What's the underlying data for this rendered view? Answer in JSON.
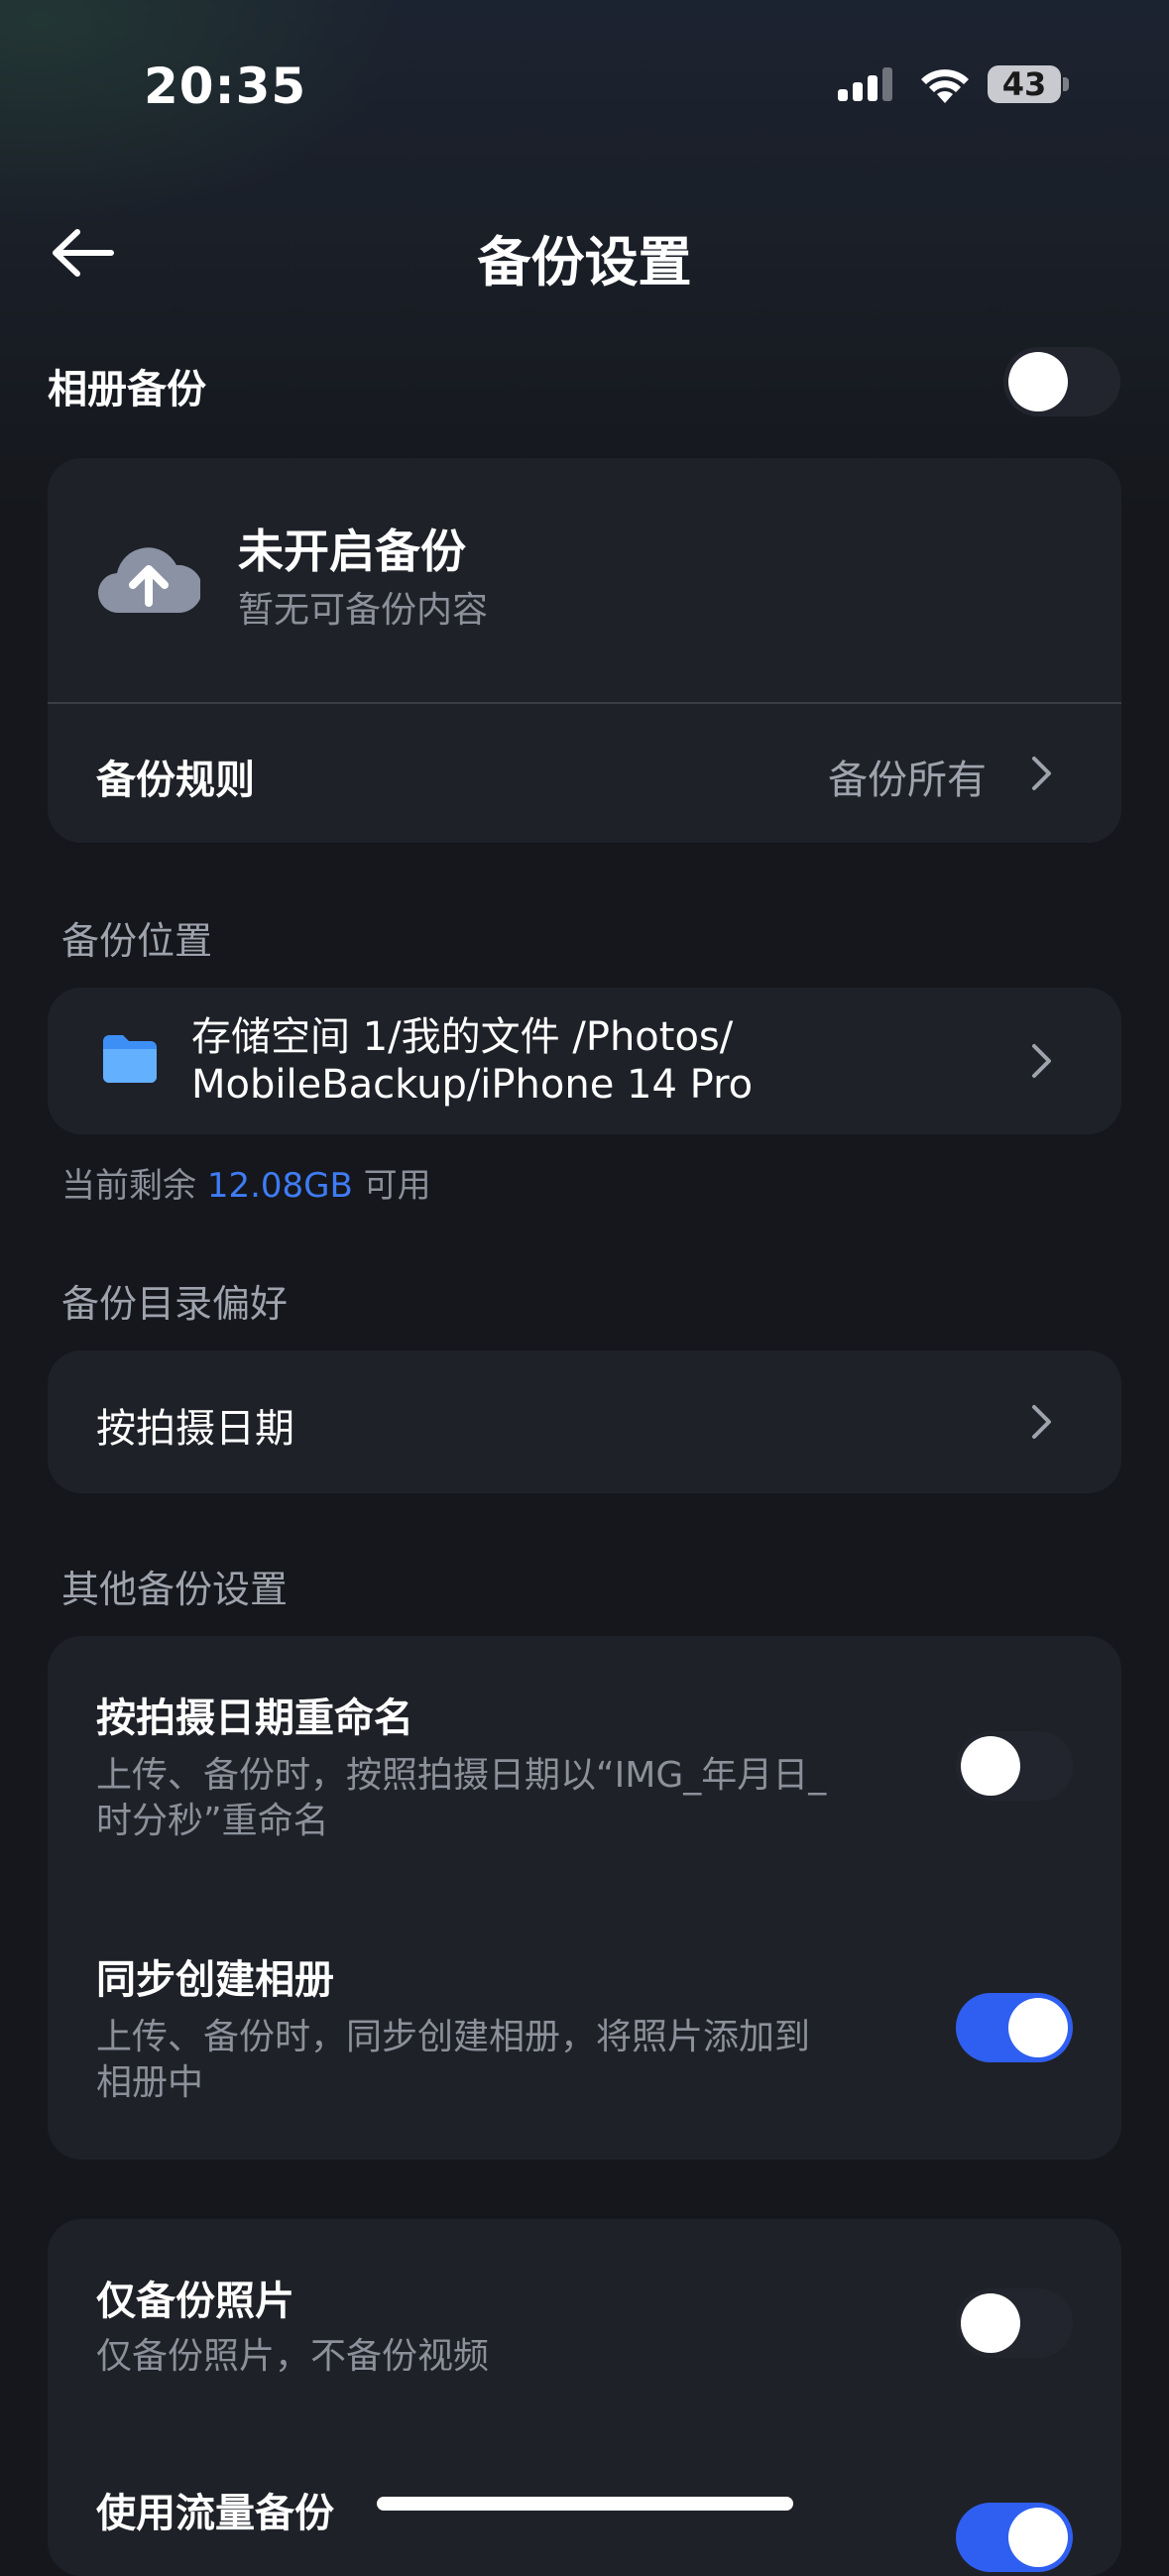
{
  "status_bar": {
    "time": "20:35",
    "battery": "43"
  },
  "nav": {
    "title": "备份设置"
  },
  "album_backup": {
    "label": "相册备份",
    "enabled": false
  },
  "backup_status": {
    "title": "未开启备份",
    "subtitle": "暂无可备份内容",
    "rule_label": "备份规则",
    "rule_value": "备份所有"
  },
  "location": {
    "section_label": "备份位置",
    "path_line1": "存储空间 1/我的文件 /Photos/",
    "path_line2": "MobileBackup/iPhone 14 Pro",
    "remaining_prefix": "当前剩余",
    "remaining_value": "12.08GB",
    "remaining_suffix": "可用"
  },
  "directory_pref": {
    "section_label": "备份目录偏好",
    "value": "按拍摄日期"
  },
  "other_settings": {
    "section_label": "其他备份设置",
    "items": [
      {
        "title": "按拍摄日期重命名",
        "desc_line1": "上传、备份时，按照拍摄日期以“IMG_年月日_",
        "desc_line2": "时分秒”重命名",
        "enabled": false
      },
      {
        "title": "同步创建相册",
        "desc_line1": "上传、备份时，同步创建相册，将照片添加到",
        "desc_line2": "相册中",
        "enabled": true
      }
    ]
  },
  "media_settings": {
    "items": [
      {
        "title": "仅备份照片",
        "desc": "仅备份照片，不备份视频",
        "enabled": false
      },
      {
        "title": "使用流量备份",
        "enabled": true
      }
    ]
  },
  "colors": {
    "accent": "#2f5ff0",
    "link": "#3f7cf5",
    "background": "#15171c",
    "card": "#1f2128"
  }
}
